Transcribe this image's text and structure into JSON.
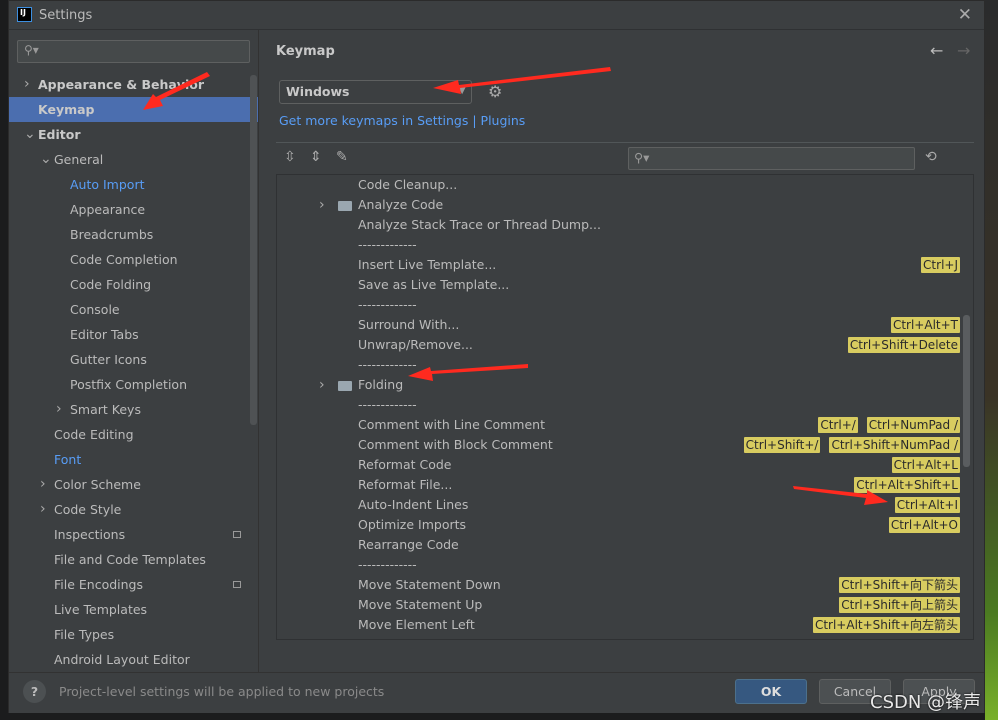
{
  "window": {
    "title": "Settings",
    "logo": "IJ",
    "close_icon": "close-icon"
  },
  "sidebar": {
    "search_placeholder": "",
    "items": [
      {
        "label": "Appearance & Behavior",
        "level": 0,
        "arrow": "›",
        "bold": true
      },
      {
        "label": "Keymap",
        "level": 0,
        "bold": true,
        "selected": true
      },
      {
        "label": "Editor",
        "level": 0,
        "arrow": "⌄",
        "bold": true
      },
      {
        "label": "General",
        "level": 1,
        "arrow": "⌄"
      },
      {
        "label": "Auto Import",
        "level": 2,
        "link": true
      },
      {
        "label": "Appearance",
        "level": 2
      },
      {
        "label": "Breadcrumbs",
        "level": 2
      },
      {
        "label": "Code Completion",
        "level": 2
      },
      {
        "label": "Code Folding",
        "level": 2
      },
      {
        "label": "Console",
        "level": 2
      },
      {
        "label": "Editor Tabs",
        "level": 2
      },
      {
        "label": "Gutter Icons",
        "level": 2
      },
      {
        "label": "Postfix Completion",
        "level": 2
      },
      {
        "label": "Smart Keys",
        "level": 2,
        "arrow": "›"
      },
      {
        "label": "Code Editing",
        "level": 1
      },
      {
        "label": "Font",
        "level": 1,
        "link": true
      },
      {
        "label": "Color Scheme",
        "level": 1,
        "arrow": "›"
      },
      {
        "label": "Code Style",
        "level": 1,
        "arrow": "›"
      },
      {
        "label": "Inspections",
        "level": 1,
        "badge": true
      },
      {
        "label": "File and Code Templates",
        "level": 1
      },
      {
        "label": "File Encodings",
        "level": 1,
        "badge": true
      },
      {
        "label": "Live Templates",
        "level": 1
      },
      {
        "label": "File Types",
        "level": 1
      },
      {
        "label": "Android Layout Editor",
        "level": 1
      }
    ]
  },
  "main": {
    "heading": "Keymap",
    "keymap_value": "Windows",
    "get_more_link": "Get more keymaps in Settings | Plugins",
    "tree": [
      {
        "label": "Code Cleanup...",
        "keys": []
      },
      {
        "label": "Analyze Code",
        "folder": true,
        "keys": []
      },
      {
        "label": "Analyze Stack Trace or Thread Dump...",
        "keys": []
      },
      {
        "label": "-------------",
        "keys": []
      },
      {
        "label": "Insert Live Template...",
        "keys": [
          "Ctrl+J"
        ]
      },
      {
        "label": "Save as Live Template...",
        "keys": []
      },
      {
        "label": "-------------",
        "keys": []
      },
      {
        "label": "Surround With...",
        "keys": [
          "Ctrl+Alt+T"
        ]
      },
      {
        "label": "Unwrap/Remove...",
        "keys": [
          "Ctrl+Shift+Delete"
        ]
      },
      {
        "label": "-------------",
        "keys": []
      },
      {
        "label": "Folding",
        "folder": true,
        "keys": []
      },
      {
        "label": "-------------",
        "keys": []
      },
      {
        "label": "Comment with Line Comment",
        "keys": [
          "Ctrl+/",
          "Ctrl+NumPad /"
        ]
      },
      {
        "label": "Comment with Block Comment",
        "keys": [
          "Ctrl+Shift+/",
          "Ctrl+Shift+NumPad /"
        ]
      },
      {
        "label": "Reformat Code",
        "keys": [
          "Ctrl+Alt+L"
        ]
      },
      {
        "label": "Reformat File...",
        "keys": [
          "Ctrl+Alt+Shift+L"
        ]
      },
      {
        "label": "Auto-Indent Lines",
        "keys": [
          "Ctrl+Alt+I"
        ]
      },
      {
        "label": "Optimize Imports",
        "keys": [
          "Ctrl+Alt+O"
        ]
      },
      {
        "label": "Rearrange Code",
        "keys": []
      },
      {
        "label": "-------------",
        "keys": []
      },
      {
        "label": "Move Statement Down",
        "keys": [
          "Ctrl+Shift+向下箭头"
        ]
      },
      {
        "label": "Move Statement Up",
        "keys": [
          "Ctrl+Shift+向上箭头"
        ]
      },
      {
        "label": "Move Element Left",
        "keys": [
          "Ctrl+Alt+Shift+向左箭头"
        ]
      }
    ]
  },
  "footer": {
    "help": "?",
    "text": "Project-level settings will be applied to new projects",
    "ok": "OK",
    "cancel": "Cancel",
    "apply": "Apply"
  },
  "watermark": "CSDN @锋声",
  "colors": {
    "selection": "#4b6eaf",
    "link": "#589df6",
    "shortcut": "#d8cc60",
    "annotation_arrow": "#ff2a1f"
  }
}
